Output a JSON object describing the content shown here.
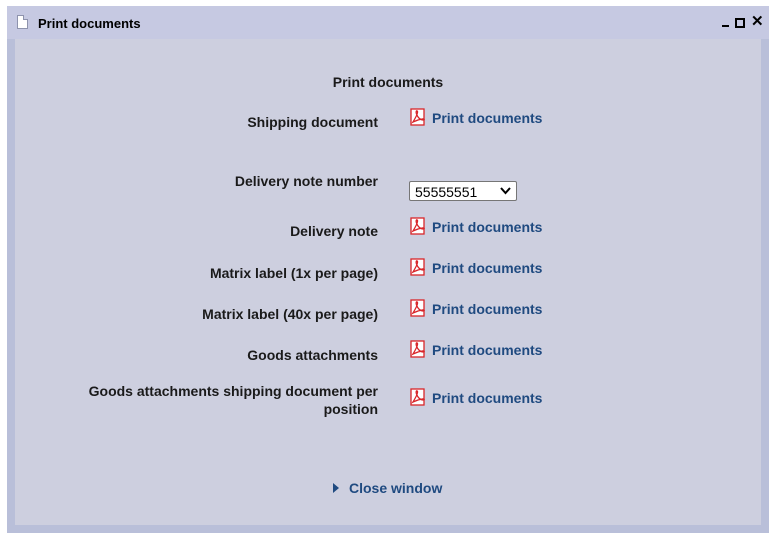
{
  "window": {
    "title": "Print documents",
    "controls": {
      "minimize": "_",
      "maximize": "□",
      "close": "✕"
    }
  },
  "main": {
    "heading": "Print documents",
    "rows": [
      {
        "label": "Shipping document",
        "link": "Print documents"
      },
      {
        "label": "Delivery note number",
        "select_value": "55555551"
      },
      {
        "label": "Delivery note",
        "link": "Print documents"
      },
      {
        "label": "Matrix label (1x per page)",
        "link": "Print documents"
      },
      {
        "label": "Matrix label (40x per page)",
        "link": "Print documents"
      },
      {
        "label": "Goods attachments",
        "link": "Print documents"
      },
      {
        "label_line1": "Goods attachments shipping document per",
        "label_line2": "position",
        "link": "Print documents"
      }
    ],
    "close_label": "Close window"
  },
  "icons": {
    "pdf": "pdf-icon",
    "close_arrow": "triangle-right-icon",
    "title": "document-icon"
  },
  "colors": {
    "link": "#1f4a80",
    "panel": "#cdcfdf",
    "frame": "#b9bfd9",
    "titlebar": "#c6c9e2",
    "pdf_red": "#d9262a"
  }
}
